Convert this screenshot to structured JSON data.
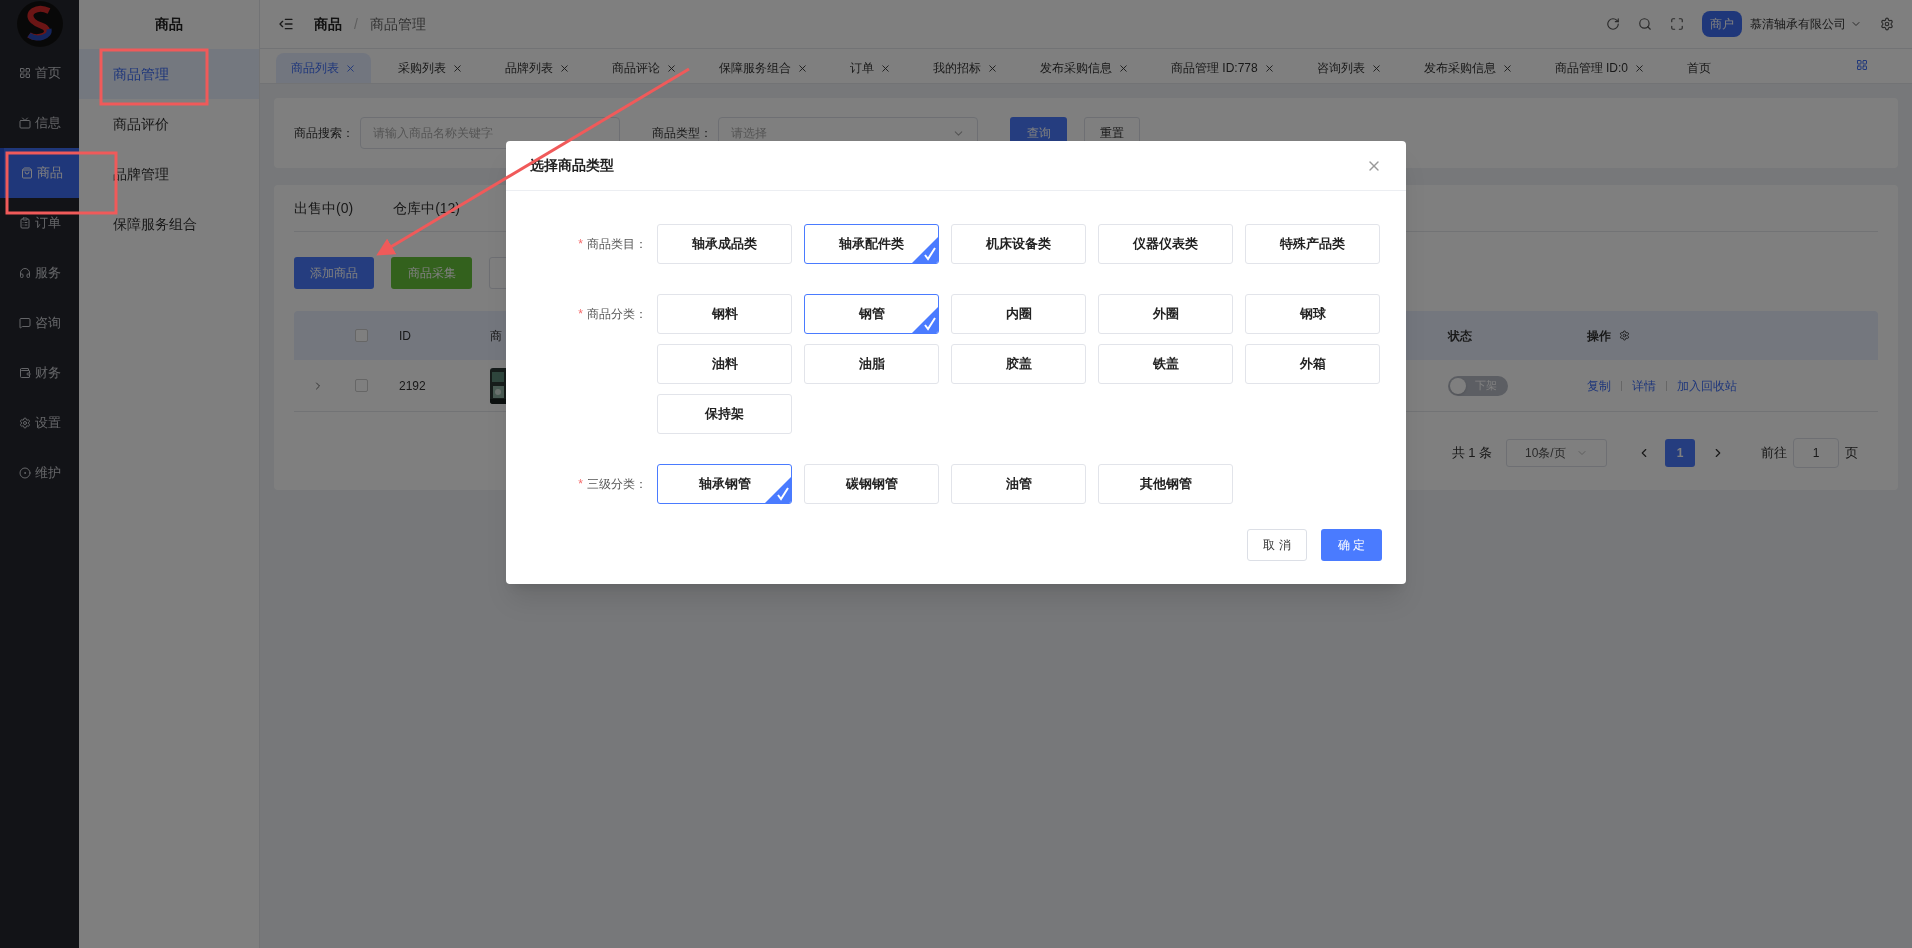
{
  "rail": {
    "items": [
      {
        "label": "首页",
        "selected": false
      },
      {
        "label": "信息",
        "selected": false
      },
      {
        "label": "商品",
        "selected": true
      },
      {
        "label": "订单",
        "selected": false
      },
      {
        "label": "服务",
        "selected": false
      },
      {
        "label": "咨询",
        "selected": false
      },
      {
        "label": "财务",
        "selected": false
      },
      {
        "label": "设置",
        "selected": false
      },
      {
        "label": "维护",
        "selected": false
      }
    ]
  },
  "submenu": {
    "title": "商品",
    "items": [
      {
        "label": "商品管理",
        "selected": true
      },
      {
        "label": "商品评价",
        "selected": false
      },
      {
        "label": "品牌管理",
        "selected": false
      },
      {
        "label": "保障服务组合",
        "selected": false
      }
    ]
  },
  "breadcrumb": {
    "items": [
      "商品",
      "商品管理"
    ],
    "separator": "/"
  },
  "header": {
    "badge": "商户",
    "company": "慕清轴承有限公司"
  },
  "tabs": [
    {
      "label": "商品列表",
      "selected": true,
      "closable": true
    },
    {
      "label": "采购列表",
      "selected": false,
      "closable": true
    },
    {
      "label": "品牌列表",
      "selected": false,
      "closable": true
    },
    {
      "label": "商品评论",
      "selected": false,
      "closable": true
    },
    {
      "label": "保障服务组合",
      "selected": false,
      "closable": true
    },
    {
      "label": "订单",
      "selected": false,
      "closable": true
    },
    {
      "label": "我的招标",
      "selected": false,
      "closable": true
    },
    {
      "label": "发布采购信息",
      "selected": false,
      "closable": true
    },
    {
      "label": "商品管理 ID:778",
      "selected": false,
      "closable": true
    },
    {
      "label": "咨询列表",
      "selected": false,
      "closable": true
    },
    {
      "label": "发布采购信息",
      "selected": false,
      "closable": true
    },
    {
      "label": "商品管理 ID:0",
      "selected": false,
      "closable": true
    },
    {
      "label": "首页",
      "selected": false,
      "closable": false
    }
  ],
  "filter": {
    "search_label": "商品搜索：",
    "search_placeholder": "请输入商品名称关键字",
    "type_label": "商品类型：",
    "type_placeholder": "请选择",
    "buttons": [
      "查询",
      "重置"
    ]
  },
  "status_tabs": [
    "出售中(0)",
    "仓库中(12)"
  ],
  "actions": [
    "添加商品",
    "商品采集"
  ],
  "table": {
    "columns": [
      "ID",
      "商",
      "状态",
      "操作"
    ],
    "header_checked": false,
    "rows": [
      {
        "id": "2192",
        "checked": false,
        "status": "下架",
        "on": false,
        "links": [
          "复制",
          "详情",
          "加入回收站"
        ]
      }
    ]
  },
  "pagination": {
    "total": "共 1 条",
    "page_size": "10条/页",
    "pages": [
      {
        "label": "1",
        "selected": true
      }
    ],
    "goto_label": "前往",
    "goto_value": "1",
    "goto_suffix": "页"
  },
  "modal": {
    "title": "选择商品类型",
    "groups": [
      {
        "label": "商品类目：",
        "required_mark": "*",
        "options": [
          {
            "label": "轴承成品类",
            "selected": false
          },
          {
            "label": "轴承配件类",
            "selected": true
          },
          {
            "label": "机床设备类",
            "selected": false
          },
          {
            "label": "仪器仪表类",
            "selected": false
          },
          {
            "label": "特殊产品类",
            "selected": false
          }
        ]
      },
      {
        "label": "商品分类：",
        "required_mark": "*",
        "options": [
          {
            "label": "钢料",
            "selected": false
          },
          {
            "label": "钢管",
            "selected": true
          },
          {
            "label": "内圈",
            "selected": false
          },
          {
            "label": "外圈",
            "selected": false
          },
          {
            "label": "钢球",
            "selected": false
          },
          {
            "label": "油料",
            "selected": false
          },
          {
            "label": "油脂",
            "selected": false
          },
          {
            "label": "胶盖",
            "selected": false
          },
          {
            "label": "铁盖",
            "selected": false
          },
          {
            "label": "外箱",
            "selected": false
          },
          {
            "label": "保持架",
            "selected": false
          }
        ]
      },
      {
        "label": "三级分类：",
        "required_mark": "*",
        "options": [
          {
            "label": "轴承钢管",
            "selected": true
          },
          {
            "label": "碳钢钢管",
            "selected": false
          },
          {
            "label": "油管",
            "selected": false
          },
          {
            "label": "其他钢管",
            "selected": false
          }
        ]
      }
    ],
    "cancel": "取 消",
    "confirm": "确 定"
  }
}
